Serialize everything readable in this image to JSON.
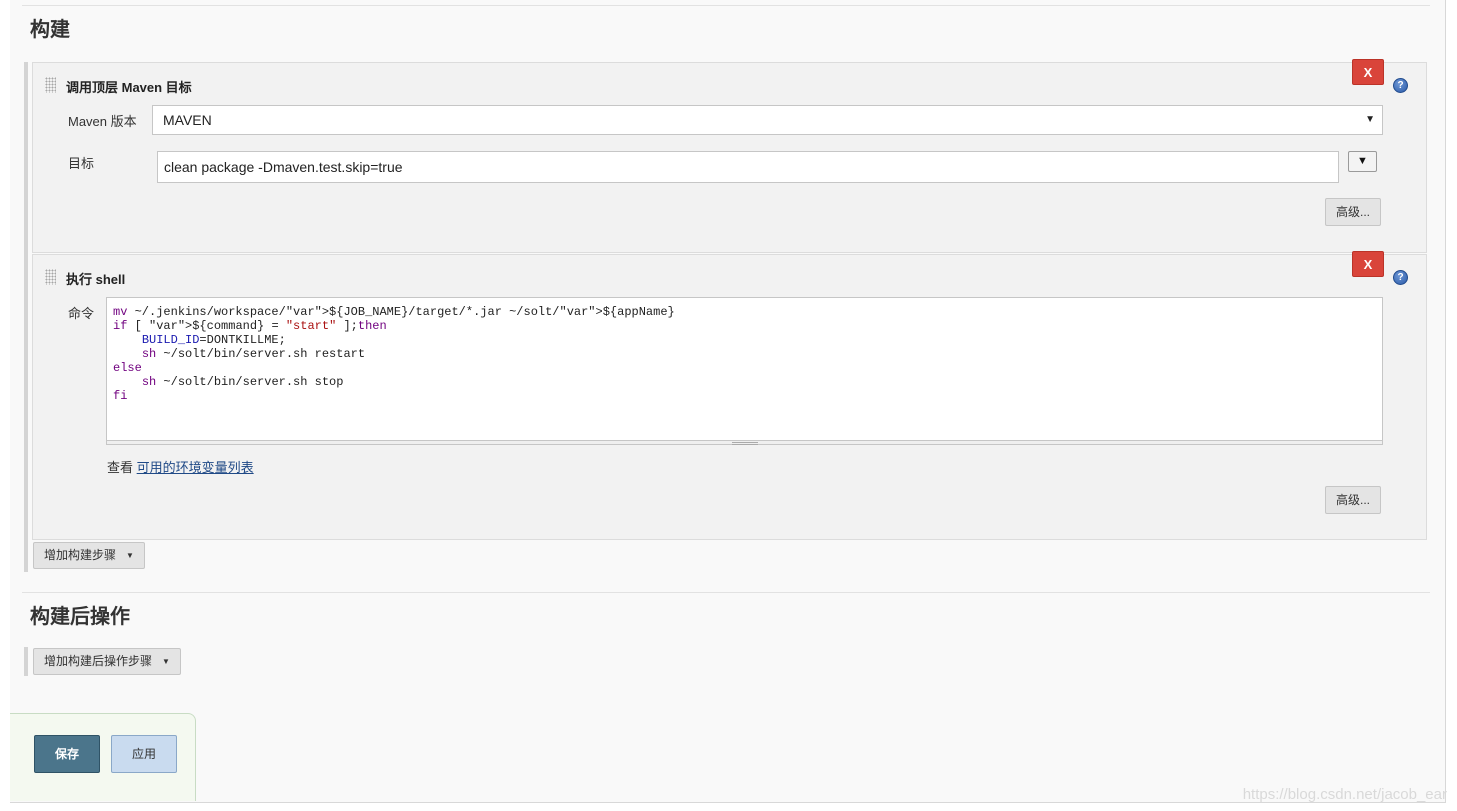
{
  "build_section": {
    "title": "构建",
    "maven_step": {
      "title": "调用顶层 Maven 目标",
      "delete_label": "X",
      "help_label": "?",
      "maven_version_label": "Maven 版本",
      "maven_version_value": "MAVEN",
      "goals_label": "目标",
      "goals_value": "clean package -Dmaven.test.skip=true",
      "expand_label": "▼",
      "advanced_label": "高级..."
    },
    "shell_step": {
      "title": "执行 shell",
      "delete_label": "X",
      "help_label": "?",
      "command_label": "命令",
      "command_text": "mv ~/.jenkins/workspace/${JOB_NAME}/target/*.jar ~/solt/${appName}\nif [ ${command} = \"start\" ];then\n    BUILD_ID=DONTKILLME;\n    sh ~/solt/bin/server.sh restart\nelse\n    sh ~/solt/bin/server.sh stop\nfi",
      "view_prefix": "查看",
      "env_link": "可用的环境变量列表",
      "advanced_label": "高级..."
    },
    "add_step_label": "增加构建步骤"
  },
  "post_build_section": {
    "title": "构建后操作",
    "add_step_label": "增加构建后操作步骤"
  },
  "footer": {
    "save_label": "保存",
    "apply_label": "应用"
  },
  "watermark": "https://blog.csdn.net/jacob_ear",
  "colors": {
    "delete": "#d9443a",
    "save": "#4b758b",
    "apply": "#c9dbef",
    "link": "#204a87"
  },
  "icons": [
    "drag-handle-icon",
    "help-icon",
    "caret-down-icon",
    "resize-grip-icon"
  ]
}
